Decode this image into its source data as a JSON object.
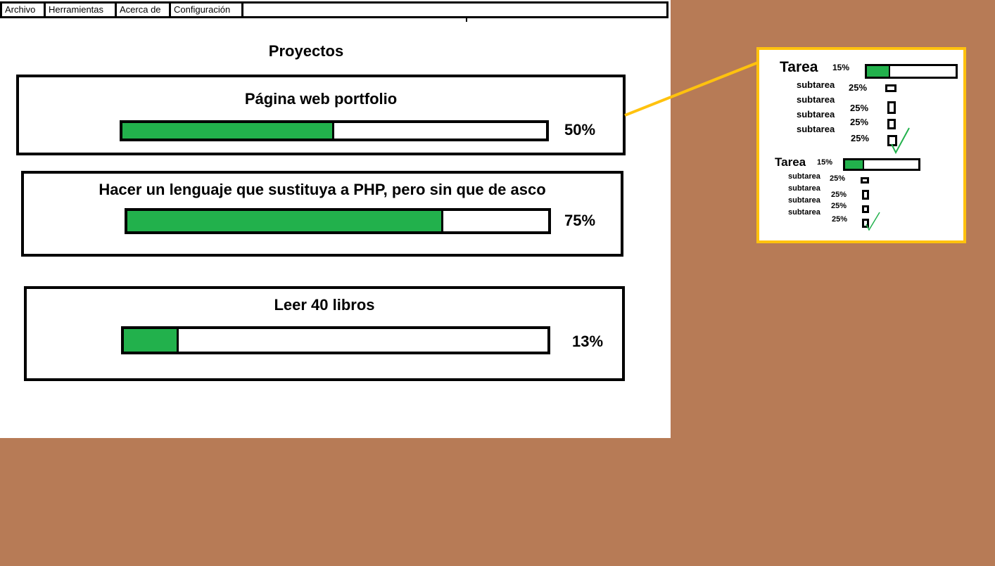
{
  "menu": {
    "items": [
      "Archivo",
      "Herramientas",
      "Acerca de",
      "Configuración"
    ]
  },
  "page": {
    "title": "Proyectos"
  },
  "projects": [
    {
      "name": "Página web portfolio",
      "progress": 50,
      "progress_label": "50%"
    },
    {
      "name": "Hacer un lenguaje que sustituya a PHP, pero sin que de asco",
      "progress": 75,
      "progress_label": "75%"
    },
    {
      "name": "Leer 40 libros",
      "progress": 13,
      "progress_label": "13%"
    }
  ],
  "detail_panel": {
    "tasks": [
      {
        "label": "Tarea",
        "percent": "15%",
        "progress": 15,
        "subtasks": [
          {
            "label": "subtarea",
            "percent": "25%"
          },
          {
            "label": "subtarea",
            "percent": "25%"
          },
          {
            "label": "subtarea",
            "percent": "25%"
          },
          {
            "label": "subtarea",
            "percent": "25%",
            "checked": true
          }
        ]
      },
      {
        "label": "Tarea",
        "percent": "15%",
        "progress": 15,
        "subtasks": [
          {
            "label": "subtarea",
            "percent": "25%"
          },
          {
            "label": "subtarea",
            "percent": "25%"
          },
          {
            "label": "subtarea",
            "percent": "25%"
          },
          {
            "label": "subtarea",
            "percent": "25%",
            "checked": true
          }
        ]
      }
    ]
  },
  "colors": {
    "desktop_bg": "#b77b56",
    "progress_fill": "#22b14c",
    "highlight": "#ffc20e",
    "checkmark": "#22b14c"
  }
}
